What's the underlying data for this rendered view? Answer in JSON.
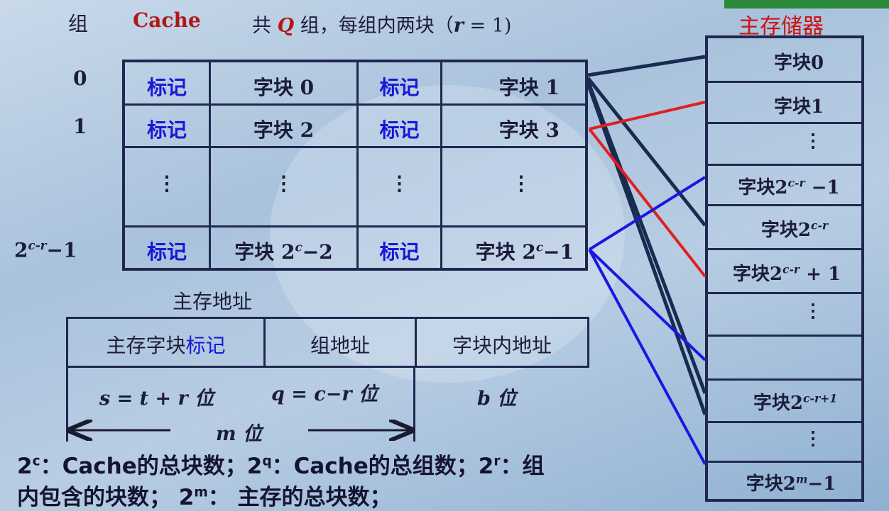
{
  "header": {
    "group_label": "组",
    "cache_label": "Cache",
    "desc_prefix": "共",
    "desc_q": "Q",
    "desc_suffix": "组，每组内两块（",
    "desc_r": "r",
    "desc_eq": "= 1)",
    "memory_title": "主存储器"
  },
  "groups": [
    "0",
    "1",
    "",
    "2c-r−1"
  ],
  "cache_rows": [
    {
      "tag1": "标记",
      "block1": "字块 0",
      "tag2": "标记",
      "block2": "字块 1"
    },
    {
      "tag1": "标记",
      "block1": "字块 2",
      "tag2": "标记",
      "block2": "字块 3"
    },
    {
      "tag1": "⋮",
      "block1": "⋮",
      "tag2": "⋮",
      "block2": "⋮"
    },
    {
      "tag1": "标记",
      "block1": "字块 2c−2",
      "tag2": "标记",
      "block2": "字块 2c−1"
    }
  ],
  "address": {
    "title": "主存地址",
    "field_tag_a": "主存字块",
    "field_tag_b": "标记",
    "field_group": "组地址",
    "field_offset": "字块内地址",
    "bits_s": "s = t + r  位",
    "bits_q": "q = c−r 位",
    "bits_b": "b 位",
    "bits_m": "m 位"
  },
  "memory_blocks": [
    "字块0",
    "字块1",
    "⋮",
    "字块2c-r −1",
    "字块2c-r",
    "字块2c-r + 1",
    "⋮",
    "",
    "字块2c-r+1",
    "⋮",
    "字块2m−1"
  ],
  "legend": {
    "line1": "2c：Cache的总块数；2q：Cache的总组数；2r：组",
    "line2": "内包含的块数； 2m： 主存的总块数；"
  },
  "colors": {
    "red": "#e02020",
    "blue": "#1818e0",
    "navy": "#1a2a50"
  }
}
